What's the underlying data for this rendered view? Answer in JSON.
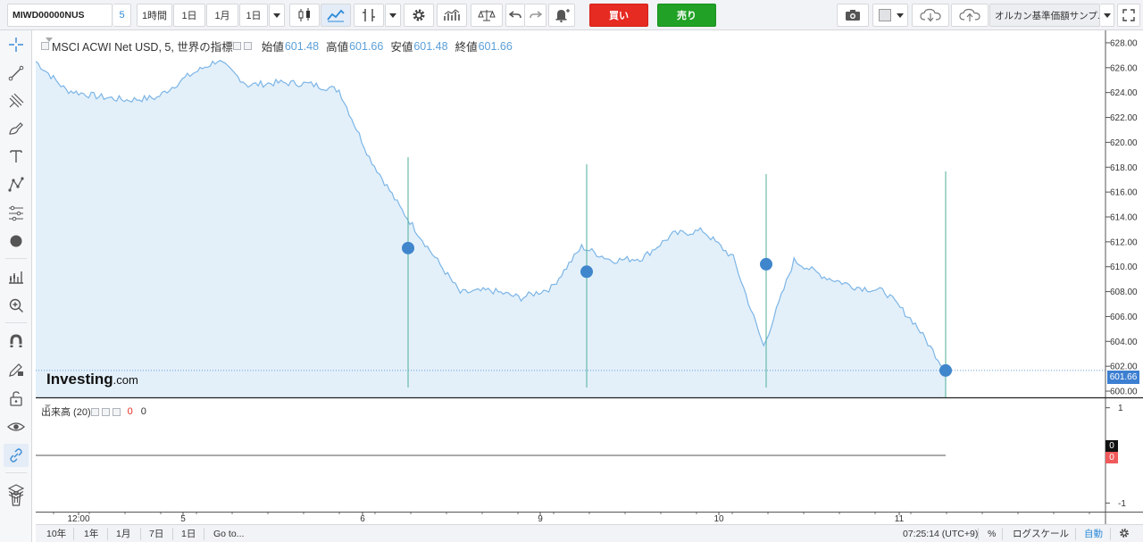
{
  "toolbar": {
    "symbol": "MIWD00000NUS",
    "interval_badge": "5",
    "intervals": [
      "1時間",
      "1日",
      "1月",
      "1日"
    ],
    "buy_label": "買い",
    "sell_label": "売り",
    "fund_search": "オルカン基準価額サンプ..."
  },
  "legend": {
    "title": "MSCI ACWI Net USD, 5, 世界の指標",
    "open_label": "始値",
    "open": "601.48",
    "high_label": "高値",
    "high": "601.66",
    "low_label": "安値",
    "low": "601.48",
    "close_label": "終値",
    "close": "601.66"
  },
  "volume_legend": {
    "title": "出来高 (20)",
    "value_red": "0",
    "value_black": "0"
  },
  "watermark": {
    "brand": "Investing",
    "suffix": ".com"
  },
  "price_tag": "601.66",
  "volume_tags": {
    "top": "0",
    "bottom": "0"
  },
  "price_axis_ticks": [
    "628.00",
    "626.00",
    "624.00",
    "622.00",
    "620.00",
    "618.00",
    "616.00",
    "614.00",
    "612.00",
    "610.00",
    "608.00",
    "606.00",
    "604.00",
    "602.00",
    "600.00"
  ],
  "volume_axis_ticks": [
    "1",
    "-1"
  ],
  "time_axis": [
    "12:00",
    "5",
    "6",
    "9",
    "10",
    "11"
  ],
  "bottombar": {
    "ranges": [
      "10年",
      "1年",
      "1月",
      "7日",
      "1日"
    ],
    "goto": "Go to...",
    "clock": "07:25:14 (UTC+9)",
    "percent": "%",
    "log_scale": "ログスケール",
    "auto": "自動"
  },
  "colors": {
    "line": "#7cb5e6",
    "area": "#e3f0fa",
    "marker": "#3f86cc",
    "buy": "#e62b22",
    "sell": "#21a126",
    "accent": "#2f8bd8"
  },
  "chart_data": {
    "type": "area",
    "title": "MSCI ACWI Net USD, 5, 世界の指標",
    "x": [
      "12:00",
      "",
      "",
      "",
      "5",
      "",
      "",
      "",
      "",
      "",
      "6",
      "",
      "",
      "",
      "",
      "",
      "9",
      "",
      "",
      "",
      "",
      "",
      "10",
      "",
      "",
      "",
      "",
      "",
      "11",
      "",
      ""
    ],
    "values": [
      626.5,
      624.2,
      623.7,
      623.4,
      623.6,
      625.3,
      626.6,
      624.6,
      624.8,
      624.7,
      624.2,
      618.8,
      614.8,
      611.3,
      607.9,
      608.1,
      607.5,
      608.3,
      611.6,
      610.5,
      610.7,
      612.6,
      612.9,
      610.7,
      603.6,
      610.5,
      609.2,
      608.4,
      608.0,
      605.4,
      601.66
    ],
    "markers": [
      {
        "series_value": 611.5
      },
      {
        "series_value": 609.6
      },
      {
        "series_value": 610.2
      },
      {
        "series_value": 601.66
      }
    ],
    "ylim": [
      599.5,
      629.0
    ],
    "volume": {
      "values": [
        0
      ],
      "ylim": [
        -1.2,
        1.2
      ]
    },
    "grid": false
  }
}
